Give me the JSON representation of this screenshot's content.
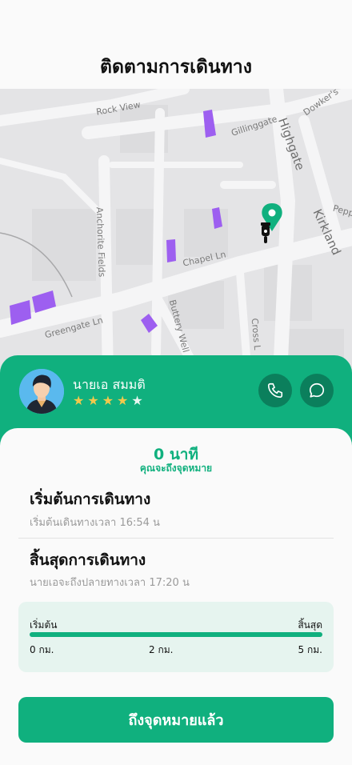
{
  "header": {
    "title": "ติดตามการเดินทาง"
  },
  "map": {
    "labels": {
      "rock_view": "Rock View",
      "gillinggate": "Gillinggate",
      "dowkers": "Dowker's",
      "highgate": "Highgate",
      "kirkland": "Kirkland",
      "pepp": "Pepp",
      "anchorite": "Anchorite Fields",
      "chapel": "Chapel Ln",
      "buttery": "Buttery Well",
      "greengate": "Greengate Ln",
      "cross": "Cross L"
    },
    "icons": {
      "destination": "map-pin-icon",
      "driver": "scooter-icon"
    }
  },
  "driver": {
    "name": "นายเอ สมมติ",
    "rating": 4,
    "rating_max": 5,
    "star_glyph": "★",
    "call_icon": "phone-icon",
    "chat_icon": "chat-bubble-icon"
  },
  "trip": {
    "eta": "0 นาที",
    "eta_caption": "คุณจะถึงจุดหมาย",
    "start": {
      "title": "เริ่มต้นการเดินทาง",
      "detail": "เริ่มต้นเดินทางเวลา 16:54 น"
    },
    "end": {
      "title": "สิ้นสุดการเดินทาง",
      "detail": "นายเอจะถึงปลายทางเวลา 17:20 น"
    },
    "progress": {
      "start_label": "เริ่มต้น",
      "end_label": "สิ้นสุด",
      "fraction": 1.0,
      "ticks": [
        "0 กม.",
        "2 กม.",
        "5 กม."
      ]
    }
  },
  "action": {
    "arrived_label": "ถึงจุดหมายแล้ว"
  },
  "colors": {
    "accent": "#10b07e",
    "accent_dark": "#0b7f5c",
    "star": "#f2c94c",
    "building": "#9d5ff0"
  }
}
